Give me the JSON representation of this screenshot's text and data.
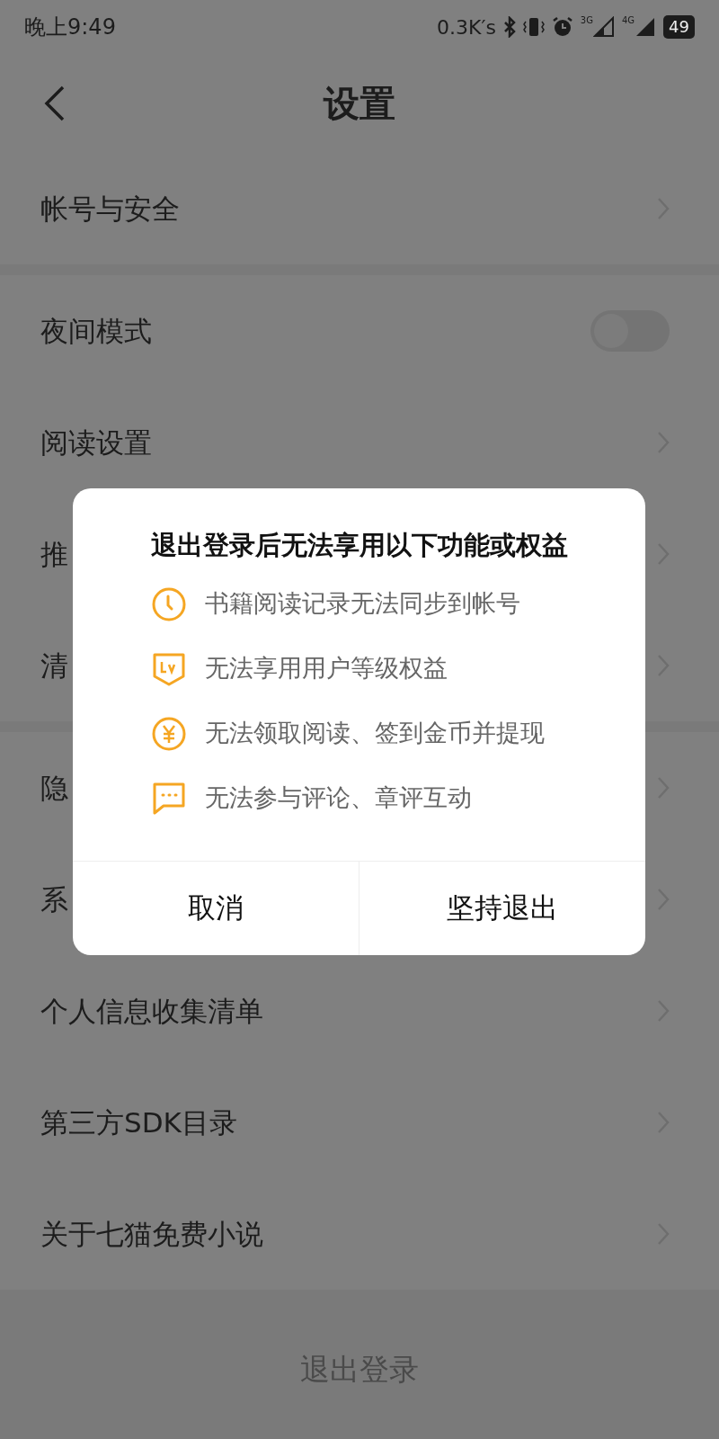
{
  "status_bar": {
    "time": "晚上9:49",
    "net_speed": "0.3K′s",
    "sim1": "3G",
    "sim2": "4G",
    "battery": "49"
  },
  "header": {
    "title": "设置"
  },
  "sections": [
    {
      "rows": [
        {
          "label": "帐号与安全",
          "kind": "link"
        }
      ]
    },
    {
      "rows": [
        {
          "label": "夜间模式",
          "kind": "toggle",
          "on": false
        },
        {
          "label": "阅读设置",
          "kind": "link"
        },
        {
          "label": "推",
          "kind": "link"
        },
        {
          "label": "清",
          "kind": "link"
        }
      ]
    },
    {
      "rows": [
        {
          "label": "隐",
          "kind": "link"
        },
        {
          "label": "系",
          "kind": "link"
        },
        {
          "label": "个人信息收集清单",
          "kind": "link"
        },
        {
          "label": "第三方SDK目录",
          "kind": "link"
        },
        {
          "label": "关于七猫免费小说",
          "kind": "link"
        }
      ]
    }
  ],
  "logout": "退出登录",
  "dialog": {
    "title": "退出登录后无法享用以下功能或权益",
    "items": [
      {
        "kind": "clock",
        "text": "书籍阅读记录无法同步到帐号"
      },
      {
        "kind": "level",
        "text": "无法享用用户等级权益"
      },
      {
        "kind": "coin",
        "text": "无法领取阅读、签到金币并提现"
      },
      {
        "kind": "comment",
        "text": "无法参与评论、章评互动"
      }
    ],
    "buttons": [
      "取消",
      "坚持退出"
    ]
  }
}
